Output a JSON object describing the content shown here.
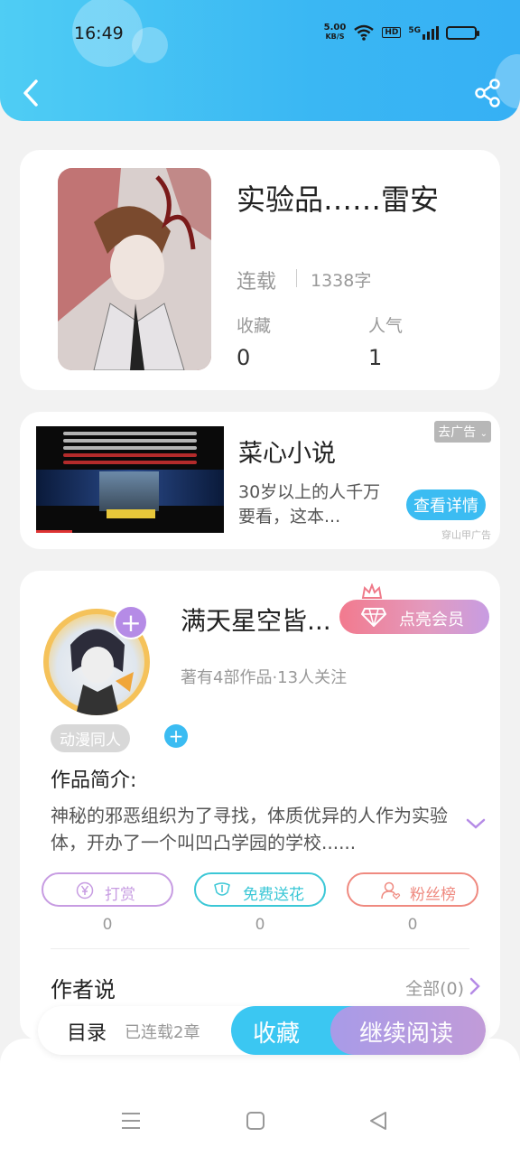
{
  "status_bar": {
    "time": "16:49",
    "speed_value": "5.00",
    "speed_unit": "KB/S",
    "hd": "HD",
    "network": "5G"
  },
  "header": {
    "back_icon": "chevron-left-icon",
    "share_icon": "share-icon",
    "colors": {
      "from": "#4fcdf4",
      "to": "#36b0f4"
    }
  },
  "book": {
    "title": "实验品……雷安",
    "status": "连载",
    "word_count": "1338字",
    "stats": [
      {
        "label": "收藏",
        "value": "0"
      },
      {
        "label": "人气",
        "value": "1"
      }
    ]
  },
  "ad": {
    "title": "菜心小说",
    "description": "30岁以上的人千万要看，这本...",
    "remove_label": "去广告",
    "detail_button": "查看详情",
    "source": "穿山甲广告"
  },
  "author": {
    "name": "满天星空皆...",
    "vip_button": "点亮会员",
    "meta": "著有4部作品·13人关注",
    "tag": "动漫同人",
    "intro_title": "作品简介:",
    "intro_text": "神秘的邪恶组织为了寻找，体质优异的人作为实验体，开办了一个叫凹凸学园的学校......",
    "actions": [
      {
        "label": "打赏",
        "count": "0",
        "icon": "yen-coin-icon",
        "color": "#c79ce2"
      },
      {
        "label": "免费送花",
        "count": "0",
        "icon": "flower-icon",
        "color": "#3bc7d6"
      },
      {
        "label": "粉丝榜",
        "count": "0",
        "icon": "fan-user-icon",
        "color": "#ef8a80"
      }
    ],
    "say_title": "作者说",
    "say_all": "全部(0)"
  },
  "action_bar": {
    "toc": "目录",
    "serial": "已连载2章",
    "collect": "收藏",
    "continue": "继续阅读"
  },
  "navbar": {
    "items": [
      "menu-icon",
      "home-square-icon",
      "back-triangle-icon"
    ]
  }
}
